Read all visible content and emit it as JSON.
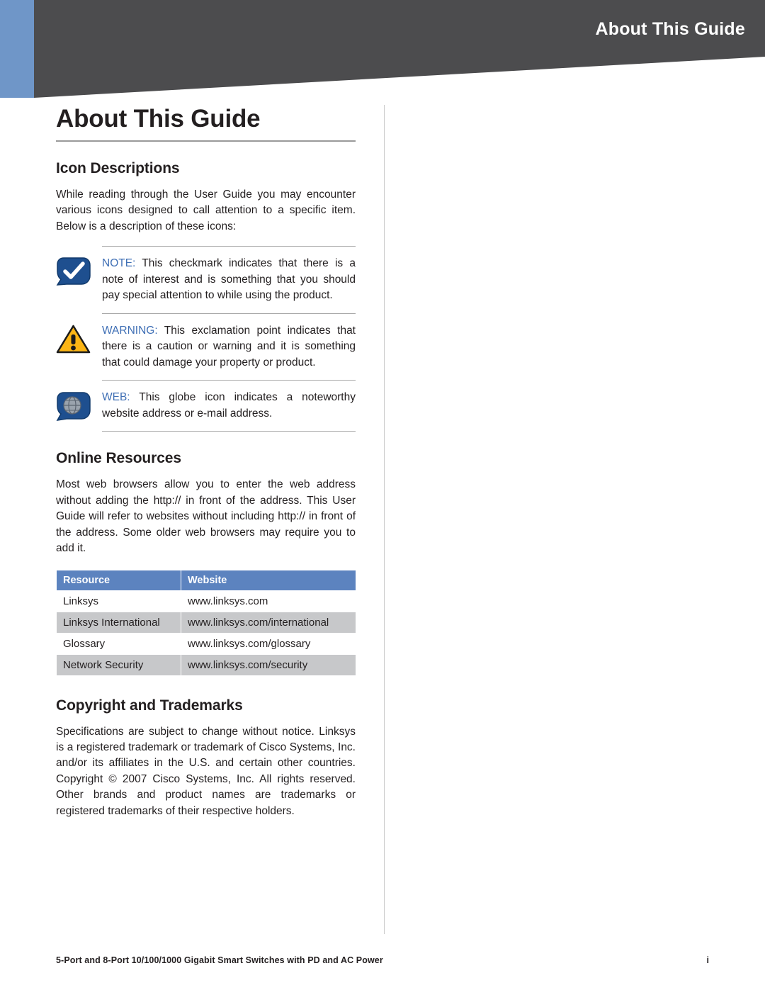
{
  "header": {
    "title": "About This Guide"
  },
  "page": {
    "title": "About This Guide"
  },
  "sections": {
    "icon_descriptions": {
      "heading": "Icon Descriptions",
      "intro": "While reading through the User Guide you may encounter various icons designed to call attention to a specific item. Below is a description of these icons:",
      "notes": [
        {
          "icon": "note-checkmark-icon",
          "label": "NOTE:",
          "text": " This checkmark indicates that there is a note of interest and is something that you should pay special attention to while using the product."
        },
        {
          "icon": "warning-triangle-icon",
          "label": "WARNING:",
          "text": " This exclamation point indicates that there is a caution or warning and it is something that could damage your property or product."
        },
        {
          "icon": "web-globe-icon",
          "label": "WEB:",
          "text": " This globe icon indicates a noteworthy website address or e-mail address."
        }
      ]
    },
    "online_resources": {
      "heading": "Online Resources",
      "intro": "Most web browsers allow you to enter the web address without adding the http:// in front of the address. This User Guide will refer to websites without including http:// in front of the address. Some older web browsers may require you to add it.",
      "table": {
        "columns": [
          "Resource",
          "Website"
        ],
        "rows": [
          [
            "Linksys",
            "www.linksys.com"
          ],
          [
            "Linksys International",
            "www.linksys.com/international"
          ],
          [
            "Glossary",
            "www.linksys.com/glossary"
          ],
          [
            "Network Security",
            "www.linksys.com/security"
          ]
        ]
      }
    },
    "copyright": {
      "heading": "Copyright and Trademarks",
      "text": "Specifications are subject to change without notice. Linksys is a registered trademark or trademark of Cisco Systems, Inc. and/or its affiliates in the U.S. and certain other countries. Copyright © 2007 Cisco Systems, Inc. All rights reserved. Other brands and product names are trademarks or registered trademarks of their respective holders."
    }
  },
  "footer": {
    "text": "5-Port and 8-Port 10/100/1000 Gigabit Smart Switches with PD and AC Power",
    "page_number": "i"
  },
  "colors": {
    "header_dark": "#4c4c4e",
    "header_blue_strip": "#6f96c8",
    "table_header": "#5c83bf",
    "table_alt_row": "#c7c8ca",
    "note_label": "#3f6fb5"
  }
}
